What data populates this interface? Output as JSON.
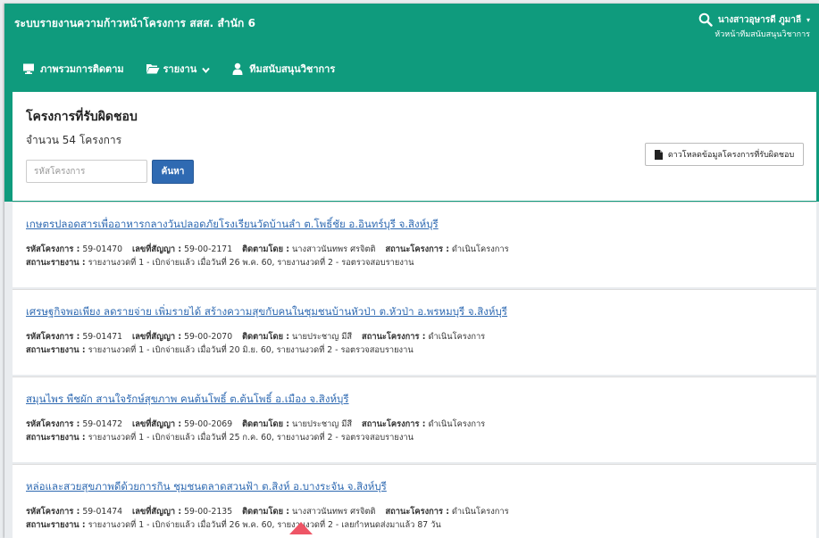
{
  "header": {
    "app_title": "ระบบรายงานความก้าวหน้าโครงการ สสส. สำนัก 6",
    "user_name": "นางสาวอุษารดี ภูมาลี",
    "user_role": "หัวหน้าทีมสนับสนุนวิชาการ",
    "nav": [
      {
        "label": "ภาพรวมการติดตาม",
        "icon": "monitor-icon"
      },
      {
        "label": "รายงาน",
        "icon": "folder-open-icon"
      },
      {
        "label": "ทีมสนับสนุนวิชาการ",
        "icon": "user-icon"
      }
    ]
  },
  "panel": {
    "title": "โครงการที่รับผิดชอบ",
    "count": "จำนวน 54 โครงการ",
    "search_placeholder": "รหัสโครงการ",
    "search_button": "ค้นหา",
    "download_button": "ดาวโหลดข้อมูลโครงการที่รับผิดชอบ"
  },
  "labels": {
    "code": "รหัสโครงการ :",
    "contract": "เลขที่สัญญา :",
    "tracked_by": "ติดตามโดย :",
    "project_status": "สถานะโครงการ :",
    "report_status": "สถานะรายงาน :"
  },
  "projects": [
    {
      "title": "เกษตรปลอดสารเพื่ออาหารกลางวันปลอดภัยโรงเรียนวัดบ้านลำ ต.โพธิ์ชัย อ.อินทร์บุรี จ.สิงห์บุรี",
      "code": "59-01470",
      "contract": "59-00-2171",
      "tracked_by": "นางสาวนันทพร ศรจิตติ",
      "project_status": "ดำเนินโครงการ",
      "report_status": "รายงานงวดที่ 1 - เบิกจ่ายแล้ว เมื่อวันที่ 26 พ.ค. 60, รายงานงวดที่ 2 - รอตรวจสอบรายงาน"
    },
    {
      "title": "เศรษฐกิจพอเพียง ลดรายจ่าย เพิ่มรายได้ สร้างความสุขกับคนในชุมชนบ้านหัวป่า ต.หัวป่า อ.พรหมบุรี จ.สิงห์บุรี",
      "code": "59-01471",
      "contract": "59-00-2070",
      "tracked_by": "นายประชาญ มีสี",
      "project_status": "ดำเนินโครงการ",
      "report_status": "รายงานงวดที่ 1 - เบิกจ่ายแล้ว เมื่อวันที่ 20 มิ.ย. 60, รายงานงวดที่ 2 - รอตรวจสอบรายงาน"
    },
    {
      "title": "สมุนไพร พืชผัก สานใจรักษ์สุขภาพ คนต้นโพธิ์ ต.ต้นโพธิ์ อ.เมือง จ.สิงห์บุรี",
      "code": "59-01472",
      "contract": "59-00-2069",
      "tracked_by": "นายประชาญ มีสี",
      "project_status": "ดำเนินโครงการ",
      "report_status": "รายงานงวดที่ 1 - เบิกจ่ายแล้ว เมื่อวันที่ 25 ก.ค. 60, รายงานงวดที่ 2 - รอตรวจสอบรายงาน"
    },
    {
      "title": "หล่อและสวยสุขภาพดีด้วยการกิน ชุมชนตลาดสวนฟ้า ต.สิงห์ อ.บางระจัน จ.สิงห์บุรี",
      "code": "59-01474",
      "contract": "59-00-2135",
      "tracked_by": "นางสาวนันทพร ศรจิตติ",
      "project_status": "ดำเนินโครงการ",
      "report_status": "รายงานงวดที่ 1 - เบิกจ่ายแล้ว เมื่อวันที่ 26 พ.ค. 60, รายงานงวดที่ 2 - เลยกำหนดส่งมาแล้ว 87 วัน"
    }
  ],
  "colors": {
    "brand": "#0f9b7d",
    "link": "#2f6ab2",
    "primary_button": "#2f6ab2",
    "pointer": "#ee5566"
  }
}
